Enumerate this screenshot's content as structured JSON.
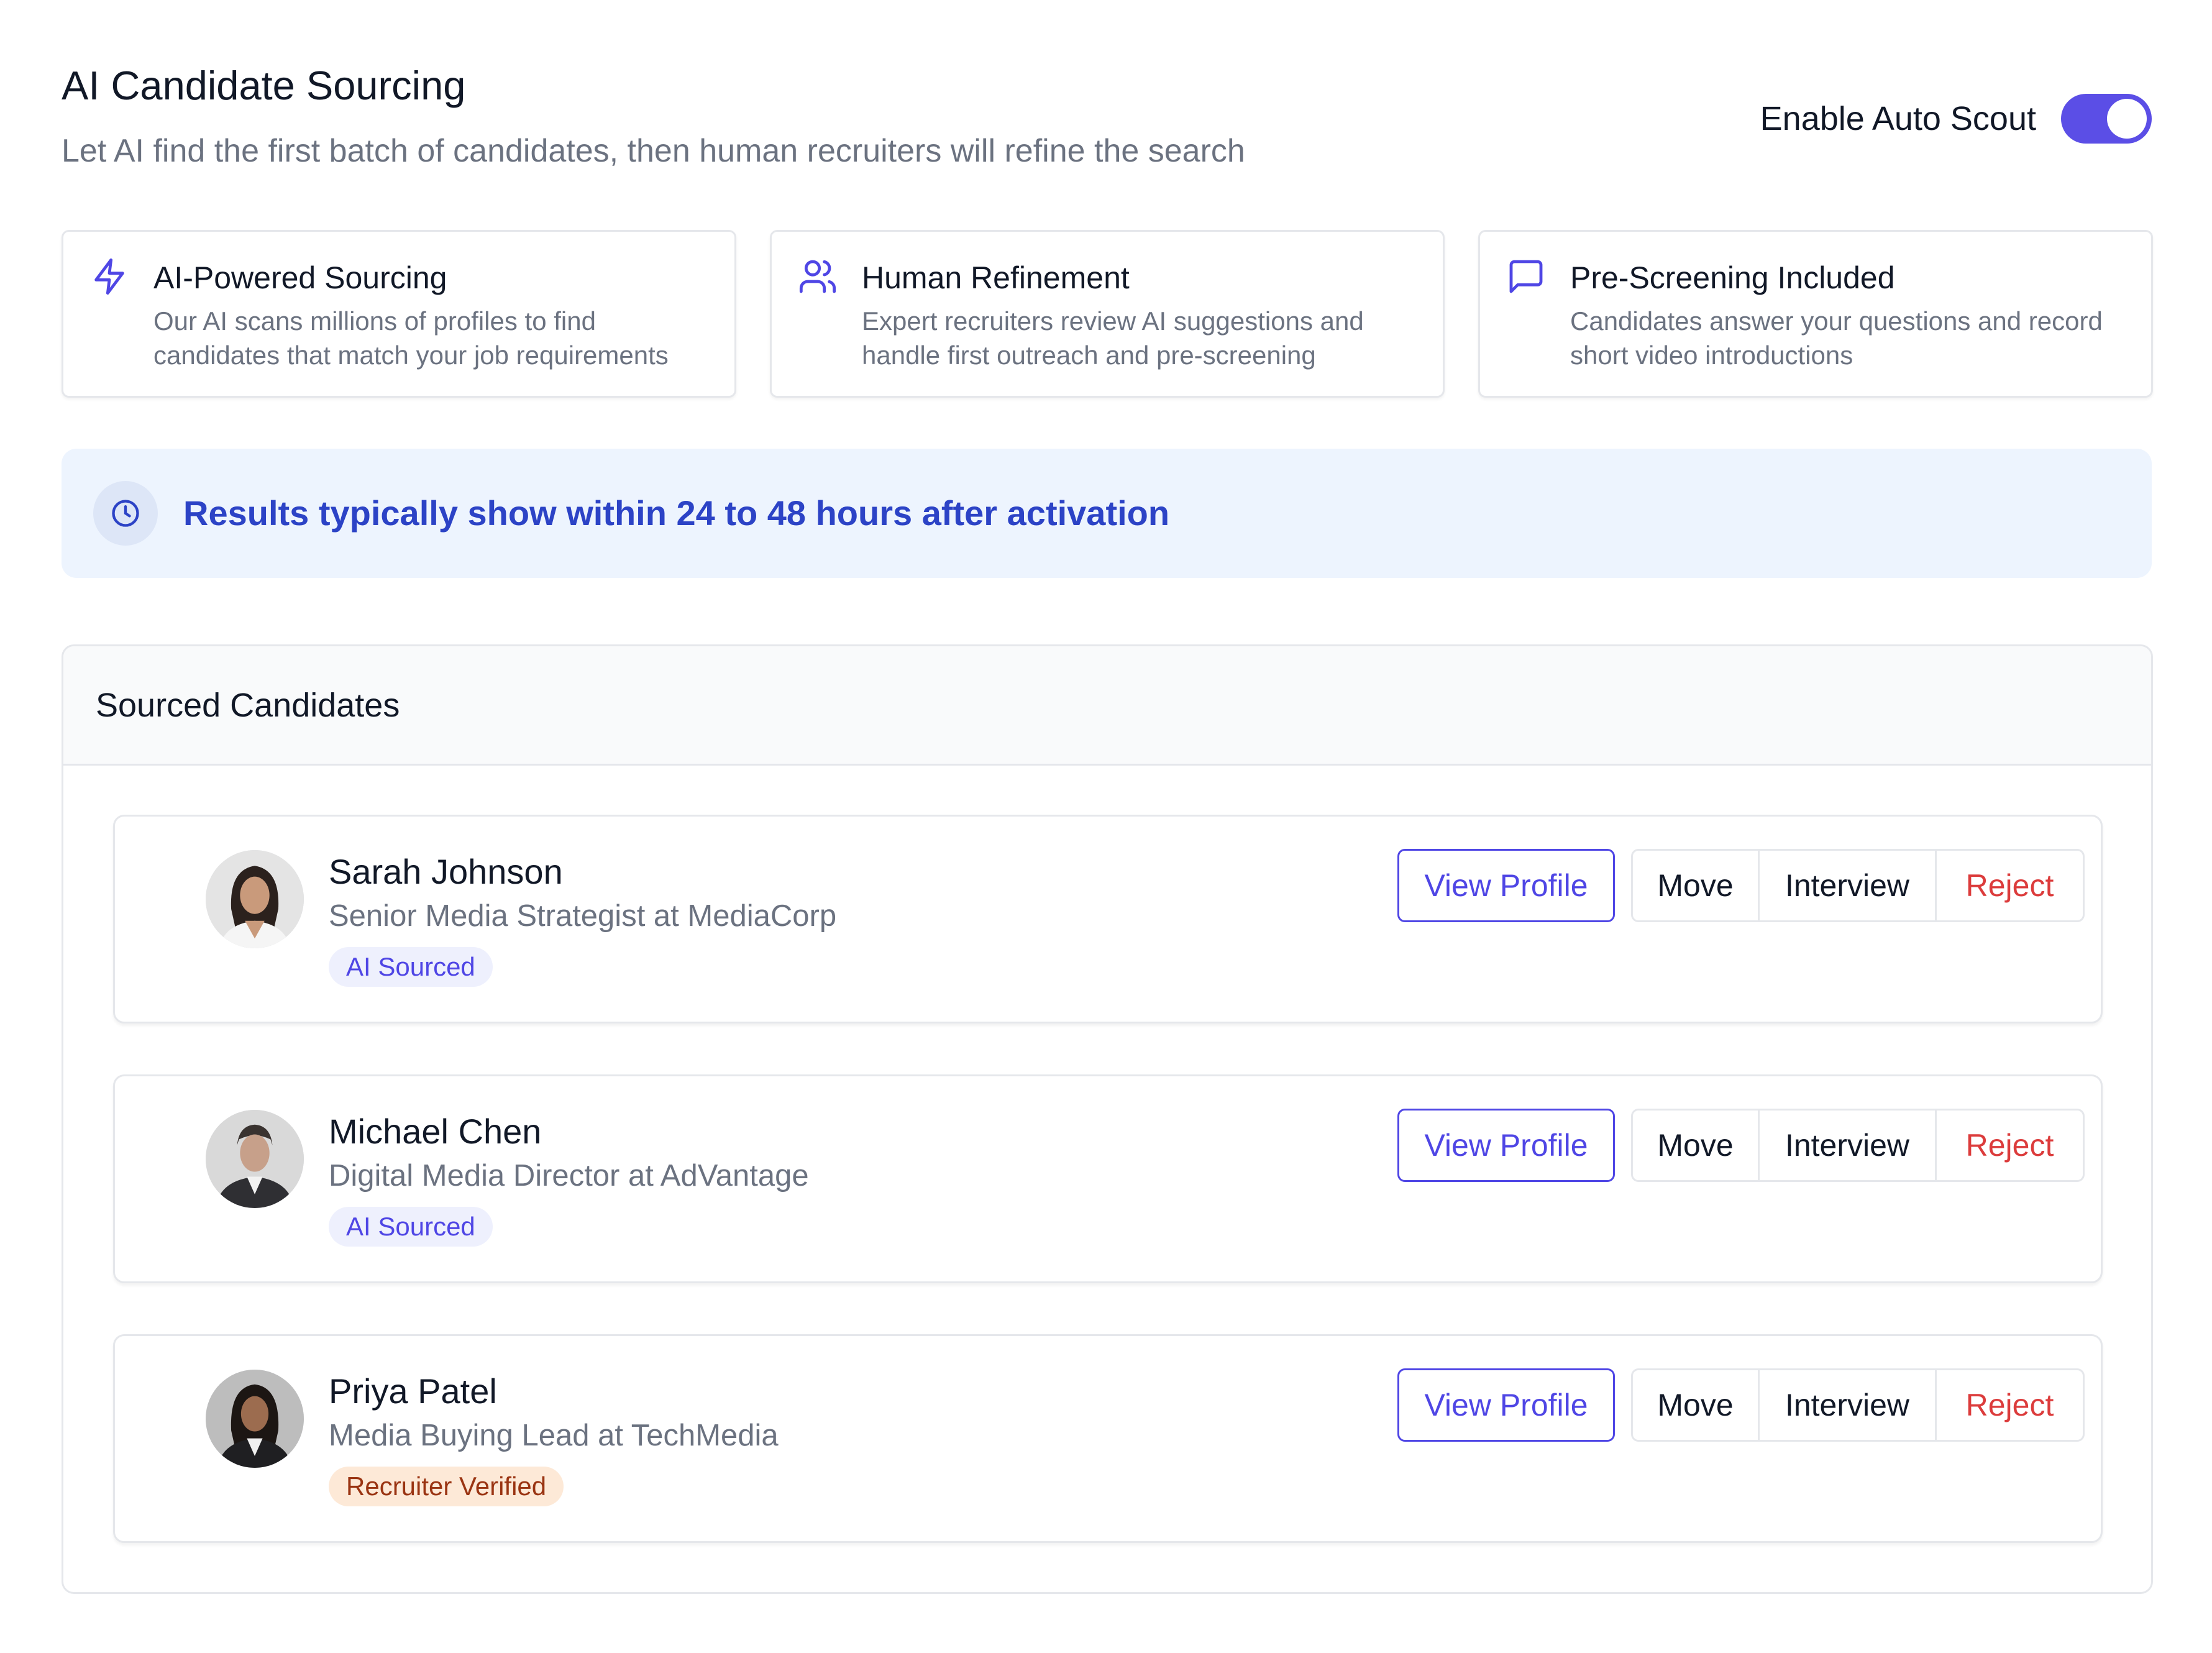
{
  "header": {
    "title": "AI Candidate Sourcing",
    "subtitle": "Let AI find the first batch of candidates, then human recruiters will refine the search",
    "auto_scout_label": "Enable Auto Scout",
    "auto_scout_enabled": true
  },
  "features": [
    {
      "icon": "lightning-icon",
      "title": "AI-Powered Sourcing",
      "description": "Our AI scans millions of profiles to find candidates that match your job requirements"
    },
    {
      "icon": "users-icon",
      "title": "Human Refinement",
      "description": "Expert recruiters review AI suggestions and handle first outreach and pre-screening"
    },
    {
      "icon": "message-square-icon",
      "title": "Pre-Screening Included",
      "description": "Candidates answer your questions and record short video introductions"
    }
  ],
  "banner": {
    "icon": "clock-icon",
    "text": "Results typically show within 24 to 48 hours after activation"
  },
  "candidates_panel": {
    "title": "Sourced Candidates",
    "candidates": [
      {
        "name": "Sarah Johnson",
        "role": "Senior Media Strategist at MediaCorp",
        "badge": "AI Sourced",
        "badge_type": "ai",
        "view_label": "View Profile",
        "move_label": "Move",
        "interview_label": "Interview",
        "reject_label": "Reject"
      },
      {
        "name": "Michael Chen",
        "role": "Digital Media Director at AdVantage",
        "badge": "AI Sourced",
        "badge_type": "ai",
        "view_label": "View Profile",
        "move_label": "Move",
        "interview_label": "Interview",
        "reject_label": "Reject"
      },
      {
        "name": "Priya Patel",
        "role": "Media Buying Lead at TechMedia",
        "badge": "Recruiter Verified",
        "badge_type": "verified",
        "view_label": "View Profile",
        "move_label": "Move",
        "interview_label": "Interview",
        "reject_label": "Reject"
      }
    ]
  },
  "colors": {
    "accent": "#4f46e5",
    "toggle": "#5b4ee6",
    "banner_bg": "#edf4fe",
    "banner_text": "#2c43c6",
    "reject": "#dc3c3c",
    "verified_bg": "#fde9d7",
    "verified_text": "#9a3412"
  }
}
